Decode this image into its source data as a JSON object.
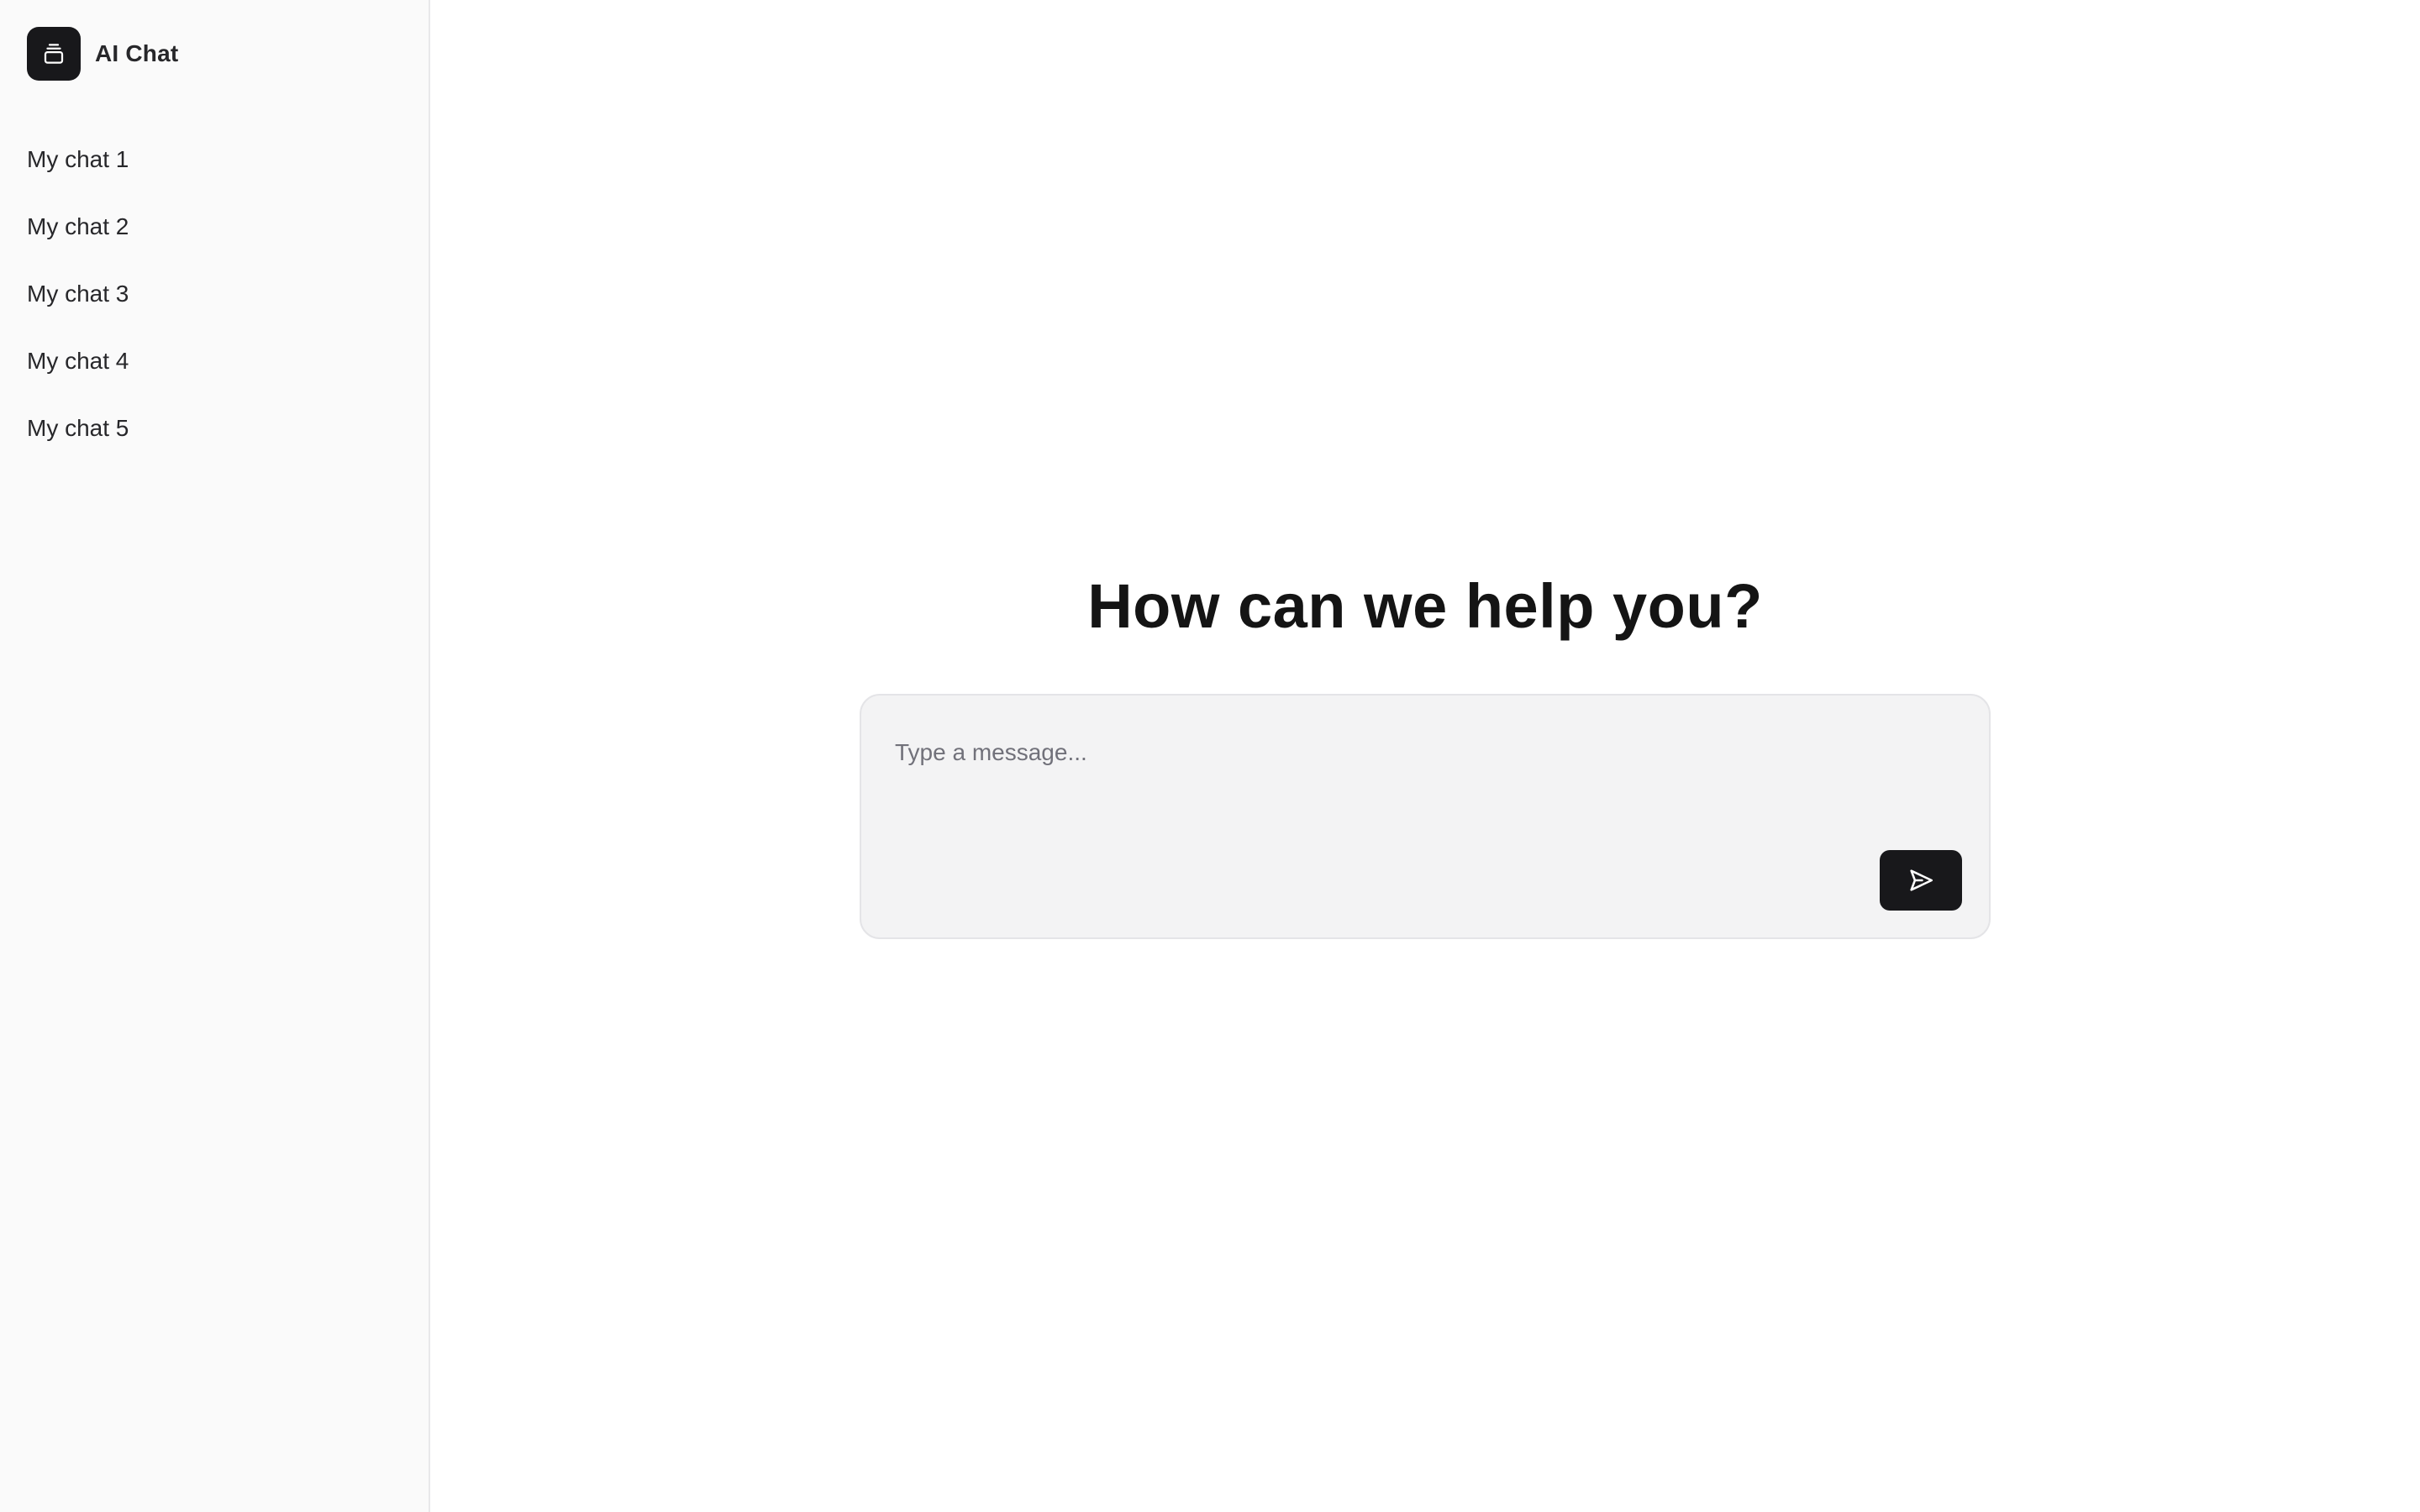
{
  "app": {
    "title": "AI Chat",
    "logo_icon": "archive-box-icon"
  },
  "sidebar": {
    "items": [
      {
        "label": "My chat 1"
      },
      {
        "label": "My chat 2"
      },
      {
        "label": "My chat 3"
      },
      {
        "label": "My chat 4"
      },
      {
        "label": "My chat 5"
      }
    ]
  },
  "main": {
    "headline": "How can we help you?",
    "composer": {
      "placeholder": "Type a message...",
      "value": "",
      "send_icon": "send-icon"
    }
  },
  "colors": {
    "accent": "#18181b",
    "sidebar_bg": "#fafafa",
    "composer_bg": "#f3f3f4"
  }
}
